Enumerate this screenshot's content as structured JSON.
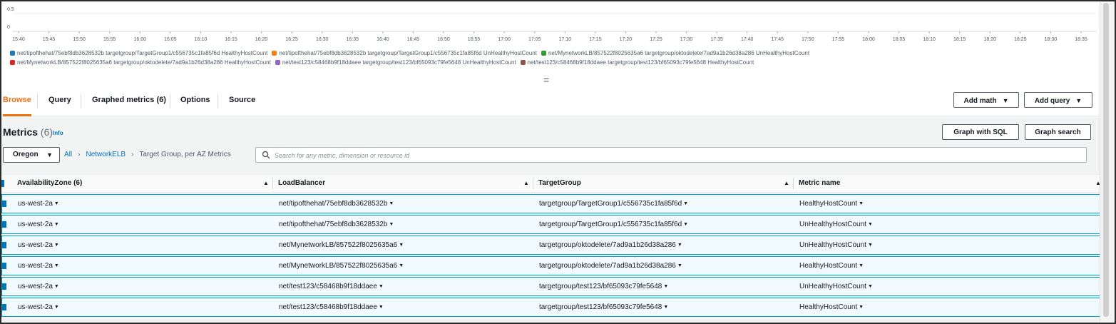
{
  "chart_data": {
    "type": "line",
    "ytick_labels": [
      "0.5",
      "0"
    ],
    "x_tick_labels": [
      "15:40",
      "15:45",
      "15:50",
      "15:55",
      "16:00",
      "16:05",
      "16:10",
      "16:15",
      "16:20",
      "16:25",
      "16:30",
      "16:35",
      "16:40",
      "16:45",
      "16:50",
      "16:55",
      "17:00",
      "17:05",
      "17:10",
      "17:15",
      "17:20",
      "17:25",
      "17:30",
      "17:35",
      "17:40",
      "17:45",
      "17:50",
      "17:55",
      "18:00",
      "18:05",
      "18:10",
      "18:15",
      "18:20",
      "18:25",
      "18:30",
      "18:35"
    ],
    "grid": true,
    "legend_position": "bottom",
    "series": [
      {
        "name": "net/tipofthehat/75ebf8db3628532b targetgroup/TargetGroup1/c556735c1fa85f6d HealthyHostCount",
        "color": "#1f77b4",
        "values": []
      },
      {
        "name": "net/tipofthehat/75ebf8db3628532b targetgroup/TargetGroup1/c556735c1fa85f6d UnHealthyHostCount",
        "color": "#ff7f0e",
        "values": []
      },
      {
        "name": "net/MynetworkLB/857522f8025635a6 targetgroup/oktodelete/7ad9a1b26d38a286 UnHealthyHostCount",
        "color": "#2ca02c",
        "values": []
      },
      {
        "name": "net/MynetworkLB/857522f8025635a6 targetgroup/oktodelete/7ad9a1b26d38a286 HealthyHostCount",
        "color": "#d62728",
        "values": []
      },
      {
        "name": "net/test123/c58468b9f18ddaee targetgroup/test123/bf65093c79fe5648 UnHealthyHostCount",
        "color": "#9467bd",
        "values": []
      },
      {
        "name": "net/test123/c58468b9f18ddaee targetgroup/test123/bf65093c79fe5648 HealthyHostCount",
        "color": "#8c564b",
        "values": []
      }
    ]
  },
  "drag_handle": "=",
  "tabs": [
    {
      "label": "Browse",
      "active": true
    },
    {
      "label": "Query"
    },
    {
      "label": "Graphed metrics (6)"
    },
    {
      "label": "Options"
    },
    {
      "label": "Source"
    }
  ],
  "buttons": {
    "add_math": "Add math",
    "add_query": "Add query",
    "graph_with_sql": "Graph with SQL",
    "graph_search": "Graph search"
  },
  "metrics": {
    "title": "Metrics",
    "count": "(6)",
    "info": "Info"
  },
  "region": "Oregon",
  "breadcrumb": {
    "all": "All",
    "namespace": "NetworkELB",
    "dimension": "Target Group, per AZ Metrics"
  },
  "search": {
    "placeholder": "Search for any metric, dimension or resource id",
    "value": ""
  },
  "table": {
    "headers": [
      "AvailabilityZone (6)",
      "LoadBalancer",
      "TargetGroup",
      "Metric name"
    ],
    "rows": [
      {
        "az": "us-west-2a",
        "lb": "net/tipofthehat/75ebf8db3628532b",
        "tg": "targetgroup/TargetGroup1/c556735c1fa85f6d",
        "metric": "HealthyHostCount"
      },
      {
        "az": "us-west-2a",
        "lb": "net/tipofthehat/75ebf8db3628532b",
        "tg": "targetgroup/TargetGroup1/c556735c1fa85f6d",
        "metric": "UnHealthyHostCount"
      },
      {
        "az": "us-west-2a",
        "lb": "net/MynetworkLB/857522f8025635a6",
        "tg": "targetgroup/oktodelete/7ad9a1b26d38a286",
        "metric": "UnHealthyHostCount"
      },
      {
        "az": "us-west-2a",
        "lb": "net/MynetworkLB/857522f8025635a6",
        "tg": "targetgroup/oktodelete/7ad9a1b26d38a286",
        "metric": "HealthyHostCount"
      },
      {
        "az": "us-west-2a",
        "lb": "net/test123/c58468b9f18ddaee",
        "tg": "targetgroup/test123/bf65093c79fe5648",
        "metric": "UnHealthyHostCount"
      },
      {
        "az": "us-west-2a",
        "lb": "net/test123/c58468b9f18ddaee",
        "tg": "targetgroup/test123/bf65093c79fe5648",
        "metric": "HealthyHostCount"
      }
    ]
  }
}
